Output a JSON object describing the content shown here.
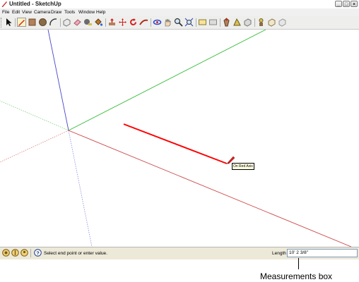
{
  "window": {
    "title": "Untitled - SketchUp",
    "minimize_glyph": "_",
    "maximize_glyph": "□",
    "close_glyph": "×"
  },
  "menubar": {
    "items": [
      "File",
      "Edit",
      "View",
      "Camera",
      "Draw",
      "Tools",
      "Window",
      "Help"
    ]
  },
  "toolbar": {
    "icons": [
      "select-icon",
      "pencil-line-icon",
      "rectangle-icon",
      "circle-icon",
      "arc-icon",
      "make-component-icon",
      "eraser-icon",
      "tape-measure-icon",
      "paint-bucket-icon",
      "push-pull-icon",
      "move-icon",
      "rotate-icon",
      "follow-me-icon",
      "orbit-icon",
      "pan-icon",
      "zoom-icon",
      "zoom-extents-icon",
      "previous-view-icon",
      "next-view-icon",
      "standard-views-icon",
      "section-plane-icon",
      "display-style-icon",
      "walk-icon",
      "look-around-icon",
      "position-camera-icon"
    ]
  },
  "canvas": {
    "tooltip": "On Red Axis",
    "axis_colors": {
      "red": "#d33a3a",
      "green": "#2fbf2f",
      "blue": "#3b3bd8"
    },
    "drawn_line_color": "#ff0000"
  },
  "statusbar": {
    "hint": "Select end point or enter value.",
    "measurement_label": "Length",
    "measurement_value": "10' 2 3/8\""
  },
  "annotation": {
    "callout": "Measurements box"
  }
}
